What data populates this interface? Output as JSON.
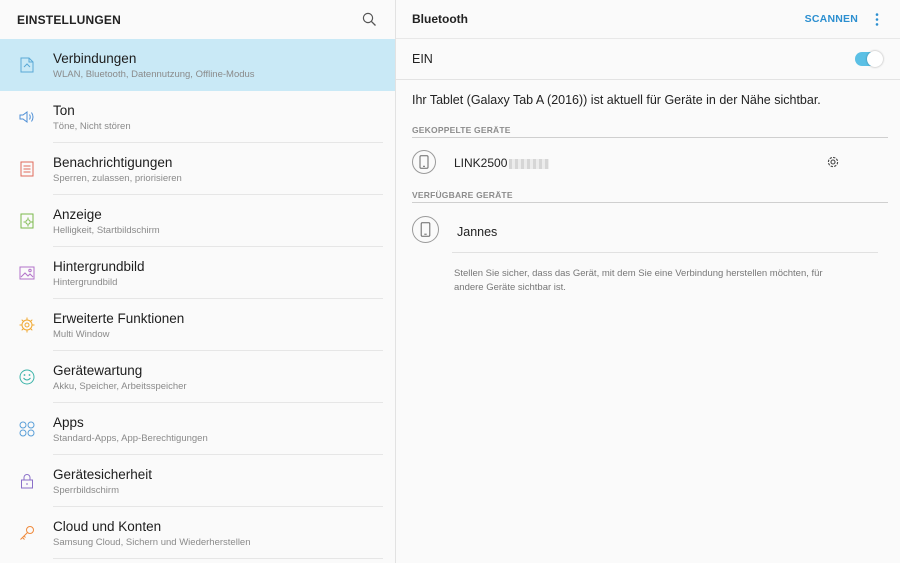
{
  "left_header": {
    "title": "EINSTELLUNGEN",
    "search_icon": "search-icon"
  },
  "menu": [
    {
      "title": "Verbindungen",
      "subtitle": "WLAN, Bluetooth, Datennutzung, Offline-Modus",
      "icon": "connections-icon",
      "color": "#5aa9d6",
      "active": true
    },
    {
      "title": "Ton",
      "subtitle": "Töne, Nicht stören",
      "icon": "sound-icon",
      "color": "#4d8fd6"
    },
    {
      "title": "Benachrichtigungen",
      "subtitle": "Sperren, zulassen, priorisieren",
      "icon": "notifications-icon",
      "color": "#e06a5a"
    },
    {
      "title": "Anzeige",
      "subtitle": "Helligkeit, Startbildschirm",
      "icon": "display-icon",
      "color": "#7ab84a"
    },
    {
      "title": "Hintergrundbild",
      "subtitle": "Hintergrundbild",
      "icon": "wallpaper-icon",
      "color": "#b271c9"
    },
    {
      "title": "Erweiterte Funktionen",
      "subtitle": "Multi Window",
      "icon": "advanced-features-icon",
      "color": "#f0a830"
    },
    {
      "title": "Gerätewartung",
      "subtitle": "Akku, Speicher, Arbeitsspeicher",
      "icon": "device-maintenance-icon",
      "color": "#3bb3a8"
    },
    {
      "title": "Apps",
      "subtitle": "Standard-Apps, App-Berechtigungen",
      "icon": "apps-icon",
      "color": "#5a9fd8"
    },
    {
      "title": "Gerätesicherheit",
      "subtitle": "Sperrbildschirm",
      "icon": "lock-icon",
      "color": "#8a6fc8"
    },
    {
      "title": "Cloud und Konten",
      "subtitle": "Samsung Cloud, Sichern und Wiederherstellen",
      "icon": "key-icon",
      "color": "#ef8a3c"
    }
  ],
  "right_header": {
    "title": "Bluetooth",
    "scan_label": "SCANNEN",
    "more_icon": "more-vert-icon"
  },
  "bluetooth": {
    "switch_label": "EIN",
    "switch_on": true,
    "visibility_message": "Ihr Tablet (Galaxy Tab A (2016)) ist aktuell für Geräte in der Nähe sichtbar.",
    "paired_header": "GEKOPPELTE GERÄTE",
    "paired_devices": [
      {
        "name": "LINK2500"
      }
    ],
    "available_header": "VERFÜGBARE GERÄTE",
    "available_devices": [
      {
        "name": "Jannes"
      }
    ],
    "hint": "Stellen Sie sicher, dass das Gerät, mit dem Sie eine Verbindung herstellen möchten, für andere Geräte sichtbar ist."
  },
  "colors": {
    "accent": "#2c8fd0",
    "active_item_bg": "#c9e9f6",
    "toggle_on": "#5bc0e5"
  }
}
